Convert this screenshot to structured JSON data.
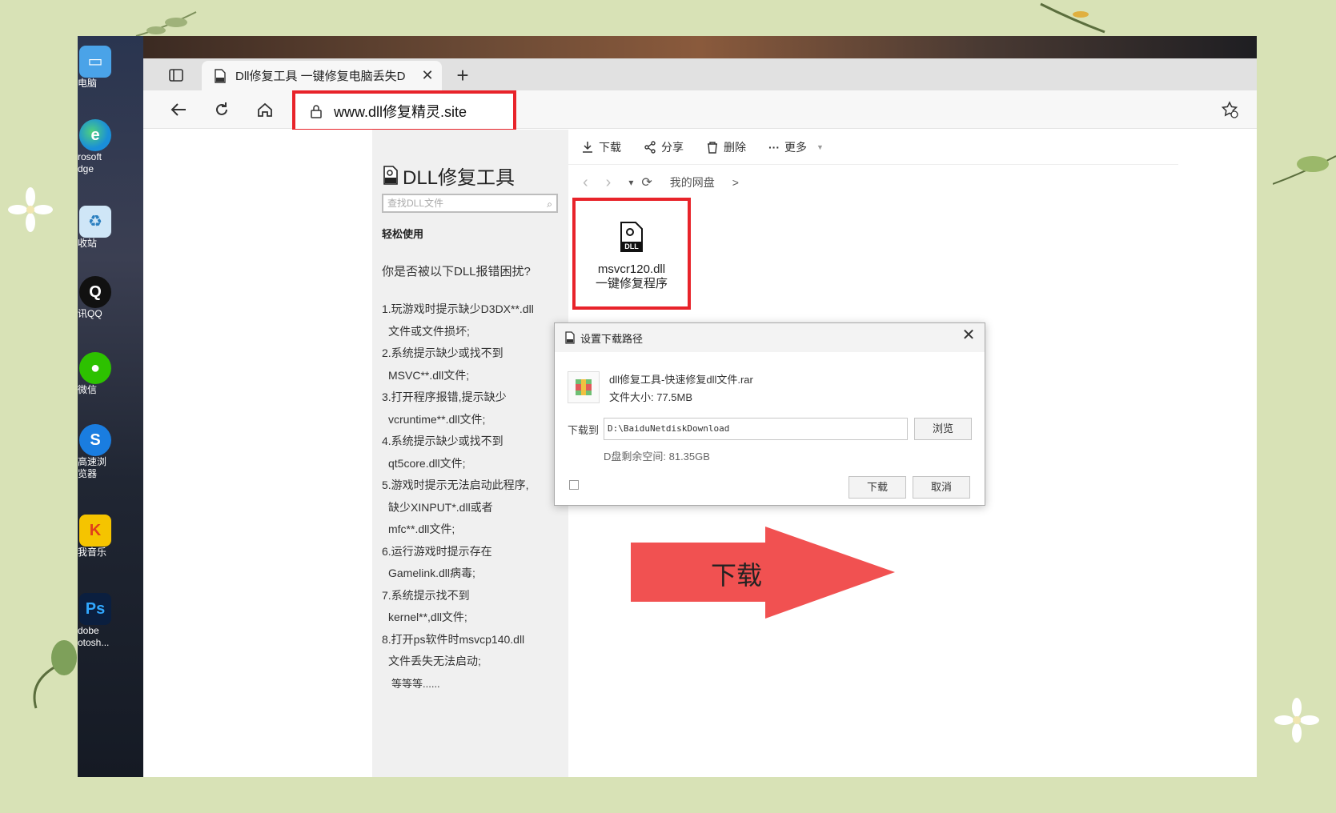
{
  "desktop": {
    "icons": [
      {
        "label": "电脑",
        "icon": "computer-icon",
        "glyph": "🖥",
        "color": "#4aa3e8"
      },
      {
        "label": "rosoft",
        "label2": "dge",
        "icon": "edge-icon",
        "glyph": "e",
        "color": "#1a8fd8"
      },
      {
        "label": "收站",
        "icon": "recycle-bin-icon",
        "glyph": "♻",
        "color": "#6fb4e0"
      },
      {
        "label": "讯QQ",
        "icon": "qq-icon",
        "glyph": "🐧",
        "color": "#111111"
      },
      {
        "label": "微信",
        "icon": "wechat-icon",
        "glyph": "●",
        "color": "#2dc100"
      },
      {
        "label": "高速浏",
        "label2": "览器",
        "icon": "sogou-browser-icon",
        "glyph": "S",
        "color": "#1a7de0"
      },
      {
        "label": "我音乐",
        "icon": "kuwo-music-icon",
        "glyph": "K",
        "color": "#f5c400"
      },
      {
        "label": "dobe",
        "label2": "otosh...",
        "icon": "photoshop-icon",
        "glyph": "Ps",
        "color": "#0b1f3f"
      }
    ]
  },
  "browser": {
    "tab_title": "Dll修复工具 一键修复电脑丢失D",
    "tab_close": "✕",
    "new_tab": "+",
    "address": "www.dll修复精灵.site"
  },
  "sidebar": {
    "brand": "DLL修复工具",
    "search_placeholder": "查找DLL文件",
    "section": "轻松使用",
    "question": "你是否被以下DLL报错困扰?",
    "items": [
      {
        "line1": "1.玩游戏时提示缺少D3DX**.dll",
        "line2": "文件或文件损坏;"
      },
      {
        "line1": "2.系统提示缺少或找不到",
        "line2": "MSVC**.dll文件;"
      },
      {
        "line1": "3.打开程序报错,提示缺少",
        "line2": "vcruntime**.dll文件;"
      },
      {
        "line1": "4.系统提示缺少或找不到",
        "line2": "qt5core.dll文件;"
      },
      {
        "line1": "5.游戏时提示无法启动此程序,",
        "line2": "缺少XINPUT*.dll或者",
        "line3": "mfc**.dll文件;"
      },
      {
        "line1": "6.运行游戏时提示存在",
        "line2": "Gamelink.dll病毒;"
      },
      {
        "line1": "7.系统提示找不到",
        "line2": "kernel**,dll文件;"
      },
      {
        "line1": "8.打开ps软件时msvcp140.dll",
        "line2": "文件丢失无法启动;"
      }
    ],
    "etc": "等等等......"
  },
  "panel": {
    "toolbar": {
      "download": "下载",
      "share": "分享",
      "delete": "删除",
      "more": "更多"
    },
    "path": {
      "back": "‹",
      "forward": "›",
      "dropdown": "▾",
      "refresh": "⟳",
      "location": "我的网盘",
      "sep": ">"
    },
    "file": {
      "name1": "msvcr120.dll",
      "name2": "一键修复程序"
    }
  },
  "dialog": {
    "title": "设置下载路径",
    "close": "✕",
    "filename": "dll修复工具-快速修复dll文件.rar",
    "filesize": "文件大小: 77.5MB",
    "path_label": "下载到",
    "path_value": "D:\\BaiduNetdiskDownload",
    "browse": "浏览",
    "free_space": "D盘剩余空间: 81.35GB",
    "download_btn": "下载",
    "cancel_btn": "取消"
  },
  "overlay": {
    "arrow_label": "下载",
    "arrow_color": "#f04a4a",
    "highlight_color": "#e8232a"
  }
}
